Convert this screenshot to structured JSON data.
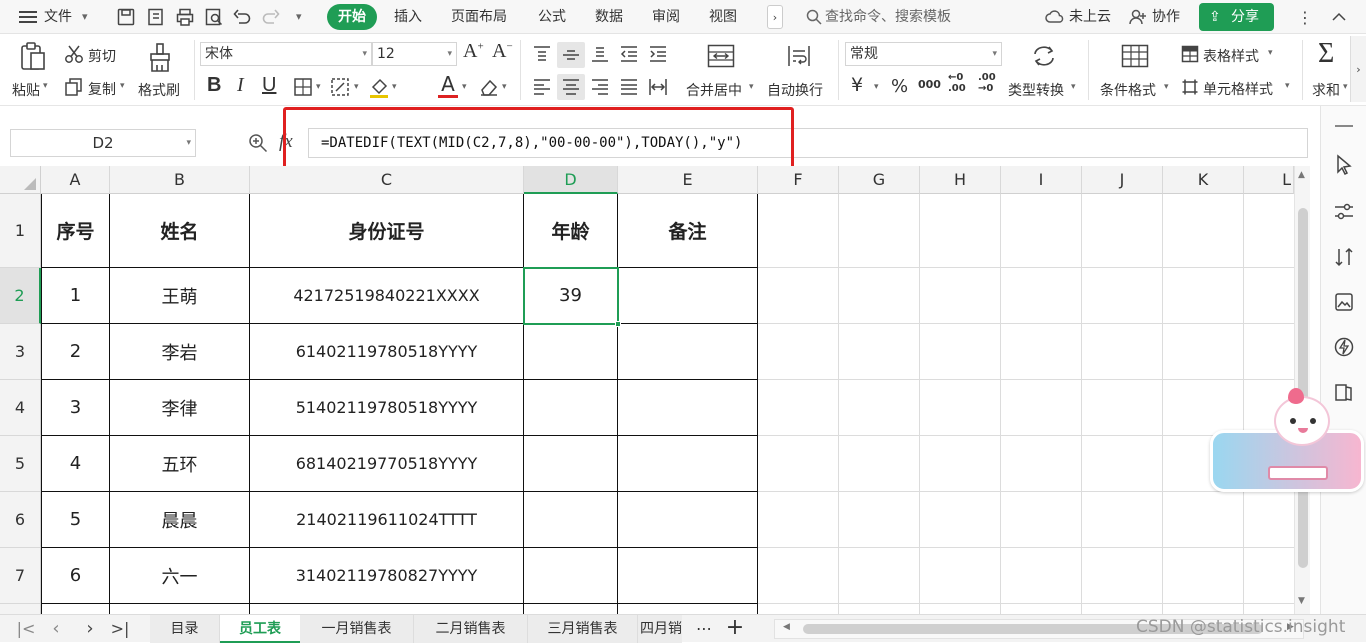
{
  "menubar": {
    "file": "文件",
    "tabs": [
      "开始",
      "插入",
      "页面布局",
      "公式",
      "数据",
      "审阅",
      "视图"
    ],
    "search_placeholder": "查找命令、搜索模板",
    "cloud": "未上云",
    "collab": "协作",
    "share": "分享"
  },
  "ribbon": {
    "paste": "粘贴",
    "cut": "剪切",
    "copy": "复制",
    "format_painter": "格式刷",
    "font_name": "宋体",
    "font_size": "12",
    "merge_center": "合并居中",
    "wrap_text": "自动换行",
    "number_format": "常规",
    "type_convert": "类型转换",
    "cond_format": "条件格式",
    "table_style": "表格样式",
    "cell_style": "单元格样式",
    "sum": "求和",
    "currency": "¥",
    "percent": "%",
    "thousands": "000",
    "inc_decimal": ".00",
    "dec_decimal": ".00"
  },
  "formula_bar": {
    "name_box": "D2",
    "fx": "fx",
    "formula": "=DATEDIF(TEXT(MID(C2,7,8),\"00-00-00\"),TODAY(),\"y\")"
  },
  "columns": [
    "A",
    "B",
    "C",
    "D",
    "E",
    "F",
    "G",
    "H",
    "I",
    "J",
    "K",
    "L"
  ],
  "rows": [
    "1",
    "2",
    "3",
    "4",
    "5",
    "6",
    "7"
  ],
  "table": {
    "headers": [
      "序号",
      "姓名",
      "身份证号",
      "年龄",
      "备注"
    ],
    "data": [
      [
        "1",
        "王萌",
        "42172519840221XXXX",
        "39",
        ""
      ],
      [
        "2",
        "李岩",
        "61402119780518YYYY",
        "",
        ""
      ],
      [
        "3",
        "李律",
        "51402119780518YYYY",
        "",
        ""
      ],
      [
        "4",
        "五环",
        "68140219770518YYYY",
        "",
        ""
      ],
      [
        "5",
        "晨晨",
        "21402119611024TTTT",
        "",
        ""
      ],
      [
        "6",
        "六一",
        "31402119780827YYYY",
        "",
        ""
      ]
    ]
  },
  "sheets": [
    "目录",
    "员工表",
    "一月销售表",
    "二月销售表",
    "三月销售表",
    "四月销"
  ],
  "active_sheet": "员工表",
  "more_sheets": "⋯",
  "add_sheet": "+",
  "watermark": "CSDN @statistics.insight",
  "colors": {
    "accent": "#1f9d55",
    "highlight_box": "#e02020",
    "selection": "#1f9d55"
  }
}
